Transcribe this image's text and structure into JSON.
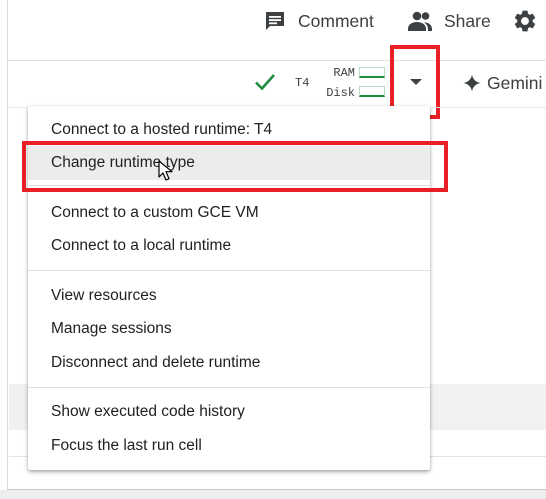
{
  "header": {
    "comment_label": "Comment",
    "share_label": "Share",
    "icons": {
      "comment": "comment-icon",
      "share": "people-icon",
      "settings": "gear-icon"
    }
  },
  "toolbar": {
    "status_icon": "check-icon",
    "gpu": "T4",
    "ram_label": "RAM",
    "disk_label": "Disk",
    "dropdown_icon": "caret-down-icon",
    "gemini_label": "Gemini",
    "gemini_icon": "sparkle-icon"
  },
  "menu": {
    "groups": [
      [
        "Connect to a hosted runtime: T4",
        "Change runtime type"
      ],
      [
        "Connect to a custom GCE VM",
        "Connect to a local runtime"
      ],
      [
        "View resources",
        "Manage sessions",
        "Disconnect and delete runtime"
      ],
      [
        "Show executed code history",
        "Focus the last run cell"
      ]
    ],
    "hovered_item": "Change runtime type"
  },
  "colors": {
    "accent_green": "#1e8e3e",
    "highlight_red": "#e81f25",
    "hover_bg": "#ececec",
    "icon_gray": "#3c4043"
  }
}
